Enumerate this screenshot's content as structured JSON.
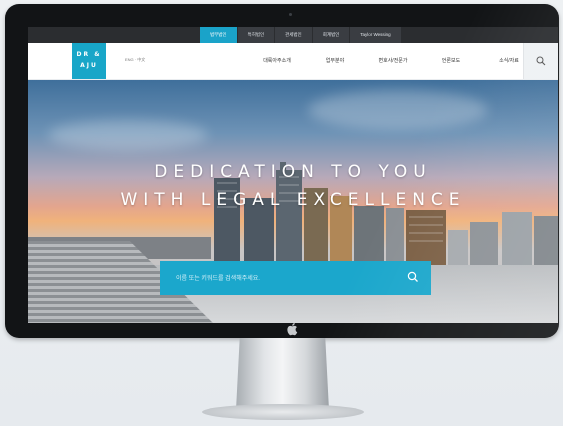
{
  "topbar": {
    "tabs": [
      {
        "label": "법무법인",
        "active": true
      },
      {
        "label": "특허법인",
        "active": false
      },
      {
        "label": "관세법인",
        "active": false
      },
      {
        "label": "회계법인",
        "active": false
      },
      {
        "label": "Taylor Wessing",
        "active": false
      }
    ]
  },
  "header": {
    "logo_line1": "DR &",
    "logo_line2": "AJU",
    "lang": "ENG · 中文",
    "nav": [
      "대륙아주소개",
      "업무분야",
      "변호사/전문가",
      "언론보도",
      "소식/자료"
    ]
  },
  "hero": {
    "headline_line1": "DEDICATION TO YOU",
    "headline_line2": "WITH LEGAL EXCELLENCE",
    "search_placeholder": "이름 또는 키워드를 검색해주세요."
  },
  "colors": {
    "accent": "#1ba7cc",
    "bezel": "#121416",
    "topbar": "#2b2d30"
  }
}
